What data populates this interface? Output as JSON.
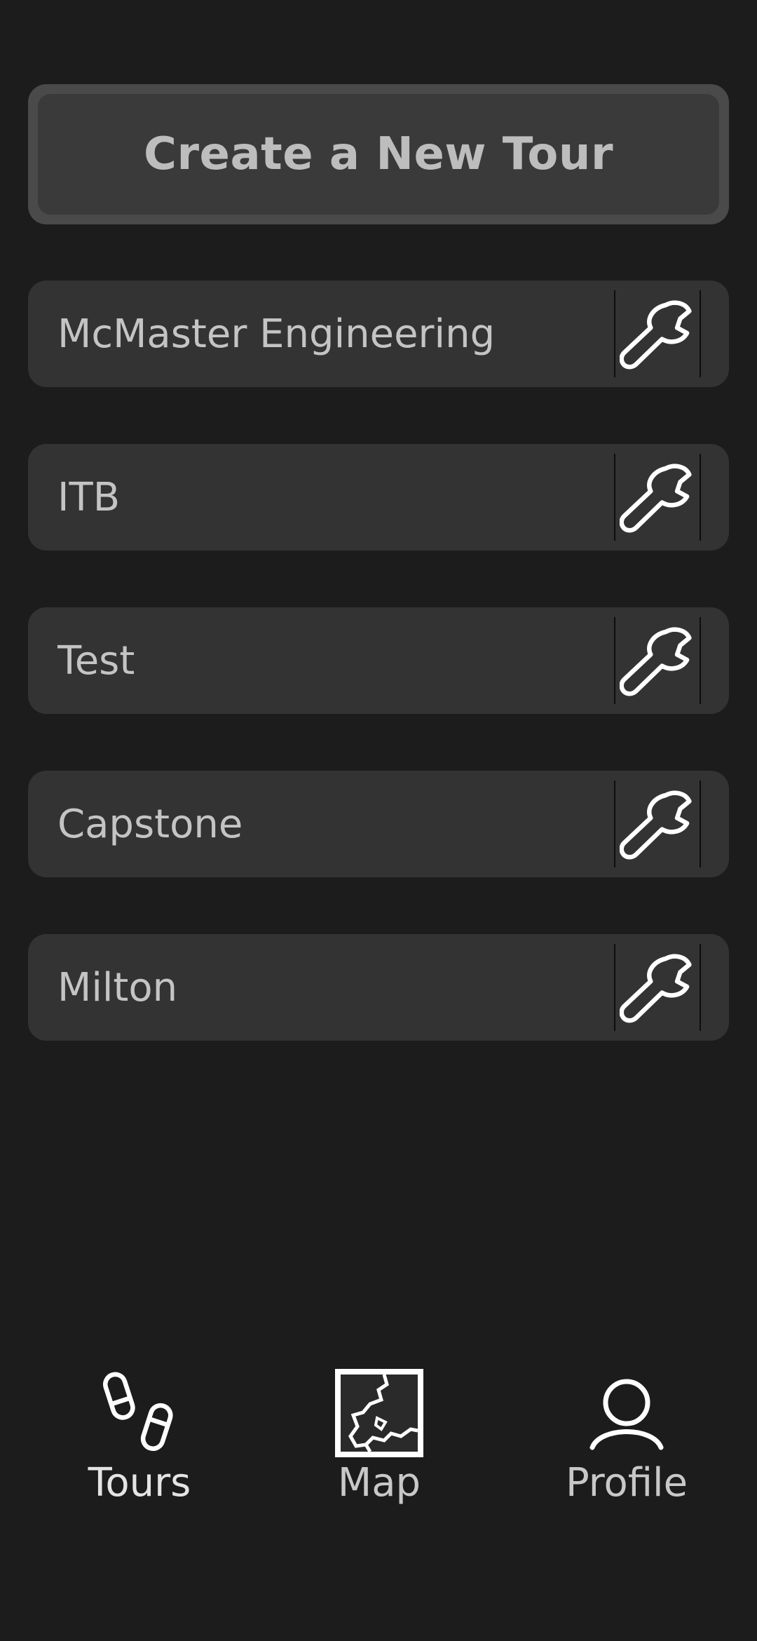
{
  "create_button": {
    "label": "Create a New Tour"
  },
  "tours": [
    {
      "name": "McMaster Engineering",
      "action_icon": "wrench-icon"
    },
    {
      "name": "ITB",
      "action_icon": "wrench-icon"
    },
    {
      "name": "Test",
      "action_icon": "wrench-icon"
    },
    {
      "name": "Capstone",
      "action_icon": "wrench-icon"
    },
    {
      "name": "Milton",
      "action_icon": "wrench-icon"
    }
  ],
  "bottom_nav": {
    "items": [
      {
        "label": "Tours",
        "icon": "footprints-icon",
        "active": true
      },
      {
        "label": "Map",
        "icon": "map-icon",
        "active": false
      },
      {
        "label": "Profile",
        "icon": "person-icon",
        "active": false
      }
    ]
  },
  "colors": {
    "background": "#1c1c1c",
    "card": "#333333",
    "create_button_border": "#4a4a4a",
    "create_button_fill": "#3a3a3a",
    "text": "#c4c4c4",
    "icon": "#ffffff"
  }
}
